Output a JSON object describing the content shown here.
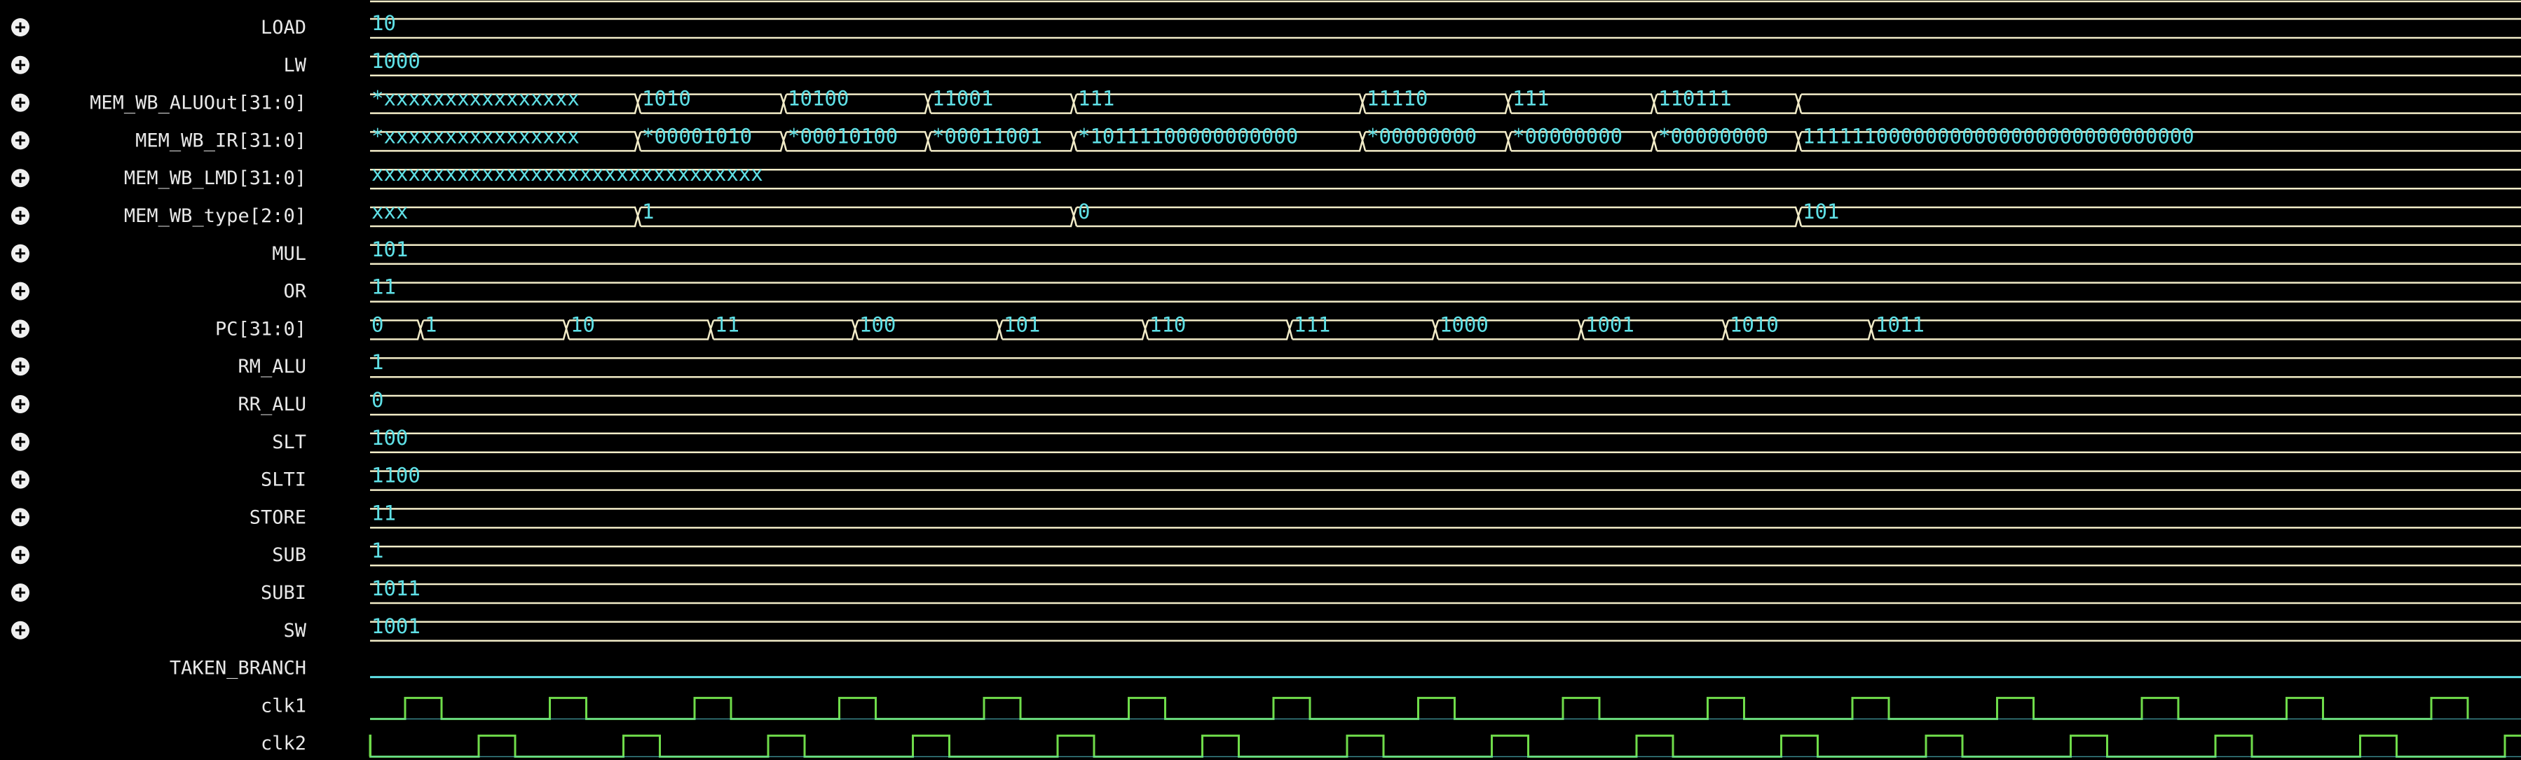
{
  "waveform": {
    "signals": [
      {
        "name": "LOAD",
        "expandable": true,
        "kind": "const",
        "value": "10"
      },
      {
        "name": "LW",
        "expandable": true,
        "kind": "const",
        "value": "1000"
      },
      {
        "name": "MEM_WB_ALUOut[31:0]",
        "expandable": true,
        "kind": "bus",
        "segments": [
          "*xxxxxxxxxxxxxxxx",
          "1010",
          "10100",
          "11001",
          "111",
          "11110",
          "111",
          "110111",
          ""
        ]
      },
      {
        "name": "MEM_WB_IR[31:0]",
        "expandable": true,
        "kind": "bus",
        "segments": [
          "*xxxxxxxxxxxxxxxx",
          "*00001010",
          "*00010100",
          "*00011001",
          "*10111100000000000",
          "*00000000",
          "*00000000",
          "*00000000",
          "11111100000000000000000000000000"
        ]
      },
      {
        "name": "MEM_WB_LMD[31:0]",
        "expandable": true,
        "kind": "const",
        "value": "xxxxxxxxxxxxxxxxxxxxxxxxxxxxxxxx"
      },
      {
        "name": "MEM_WB_type[2:0]",
        "expandable": true,
        "kind": "bus",
        "segments": [
          "xxx",
          "1",
          "0",
          "101"
        ]
      },
      {
        "name": "MUL",
        "expandable": true,
        "kind": "const",
        "value": "101"
      },
      {
        "name": "OR",
        "expandable": true,
        "kind": "const",
        "value": "11"
      },
      {
        "name": "PC[31:0]",
        "expandable": true,
        "kind": "bus",
        "segments": [
          "0",
          "1",
          "10",
          "11",
          "100",
          "101",
          "110",
          "111",
          "1000",
          "1001",
          "1010",
          "1011"
        ]
      },
      {
        "name": "RM_ALU",
        "expandable": true,
        "kind": "const",
        "value": "1"
      },
      {
        "name": "RR_ALU",
        "expandable": true,
        "kind": "const",
        "value": "0"
      },
      {
        "name": "SLT",
        "expandable": true,
        "kind": "const",
        "value": "100"
      },
      {
        "name": "SLTI",
        "expandable": true,
        "kind": "const",
        "value": "1100"
      },
      {
        "name": "STORE",
        "expandable": true,
        "kind": "const",
        "value": "11"
      },
      {
        "name": "SUB",
        "expandable": true,
        "kind": "const",
        "value": "1"
      },
      {
        "name": "SUBI",
        "expandable": true,
        "kind": "const",
        "value": "1011"
      },
      {
        "name": "SW",
        "expandable": true,
        "kind": "const",
        "value": "1001"
      },
      {
        "name": "TAKEN_BRANCH",
        "expandable": false,
        "kind": "bit",
        "value": "0"
      },
      {
        "name": "clk1",
        "expandable": false,
        "kind": "clock",
        "phase": 0
      },
      {
        "name": "clk2",
        "expandable": false,
        "kind": "clock",
        "phase": 1
      }
    ],
    "expand_icon": "plus-circle-icon",
    "colors": {
      "background": "#000000",
      "label": "#e8e8e8",
      "value": "#5fe0e6",
      "bus_line": "#f2ecc8",
      "clock": "#6fdc4a"
    }
  }
}
